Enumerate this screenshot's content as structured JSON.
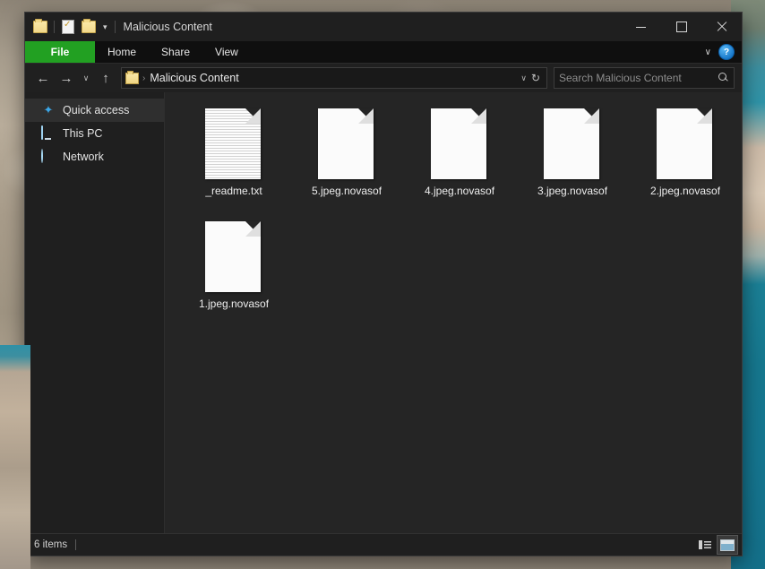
{
  "window": {
    "title": "Malicious Content",
    "quick_access_toolbar": [
      {
        "name": "folder-icon",
        "label": ""
      },
      {
        "name": "properties-icon",
        "label": ""
      },
      {
        "name": "new-folder-icon",
        "label": ""
      },
      {
        "name": "customize-caret-icon",
        "label": "▾"
      }
    ],
    "controls": {
      "minimize": "Minimize",
      "maximize": "Maximize",
      "close": "Close"
    }
  },
  "ribbon": {
    "tabs": [
      {
        "label": "File",
        "active": true
      },
      {
        "label": "Home",
        "active": false
      },
      {
        "label": "Share",
        "active": false
      },
      {
        "label": "View",
        "active": false
      }
    ],
    "expand_caret": "∨",
    "help_label": "?"
  },
  "address": {
    "back": "←",
    "forward": "→",
    "recent": "∨",
    "up": "↑",
    "breadcrumb_separator": "›",
    "breadcrumb_text": "Malicious Content",
    "dropdown_caret": "∨",
    "refresh": "↻"
  },
  "search": {
    "placeholder": "Search Malicious Content",
    "value": ""
  },
  "sidebar": {
    "items": [
      {
        "label": "Quick access",
        "icon": "star-icon",
        "selected": true
      },
      {
        "label": "This PC",
        "icon": "computer-icon",
        "selected": false
      },
      {
        "label": "Network",
        "icon": "network-icon",
        "selected": false
      }
    ]
  },
  "files": [
    {
      "name": "_readme.txt",
      "icon": "text-document-icon"
    },
    {
      "name": "5.jpeg.novasof",
      "icon": "blank-document-icon"
    },
    {
      "name": "4.jpeg.novasof",
      "icon": "blank-document-icon"
    },
    {
      "name": "3.jpeg.novasof",
      "icon": "blank-document-icon"
    },
    {
      "name": "2.jpeg.novasof",
      "icon": "blank-document-icon"
    },
    {
      "name": "1.jpeg.novasof",
      "icon": "blank-document-icon"
    }
  ],
  "statusbar": {
    "item_count": "6 items",
    "views": [
      {
        "name": "details-view-button",
        "active": false
      },
      {
        "name": "large-icons-view-button",
        "active": true
      }
    ]
  },
  "colors": {
    "file_tab_green": "#22a022",
    "window_chrome": "#1f1f1f",
    "content_background": "#252525",
    "help_blue": "#1676c8"
  }
}
